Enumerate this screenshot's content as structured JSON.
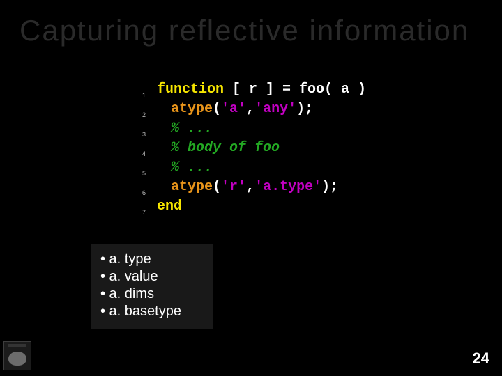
{
  "title": "Capturing reflective information",
  "code": {
    "lines": [
      {
        "n": "1",
        "tokens": [
          {
            "t": "function",
            "c": "kw"
          },
          {
            "t": " [ r ] = foo( a )",
            "c": "txt"
          }
        ]
      },
      {
        "n": "2",
        "indent": 20,
        "tokens": [
          {
            "t": "atype",
            "c": "fn"
          },
          {
            "t": "(",
            "c": "txt"
          },
          {
            "t": "'a'",
            "c": "str"
          },
          {
            "t": ",",
            "c": "txt"
          },
          {
            "t": "'any'",
            "c": "str"
          },
          {
            "t": ");",
            "c": "txt"
          }
        ]
      },
      {
        "n": "3",
        "indent": 20,
        "tokens": [
          {
            "t": "% ...",
            "c": "cmt"
          }
        ]
      },
      {
        "n": "4",
        "indent": 20,
        "tokens": [
          {
            "t": "% body of foo",
            "c": "cmt"
          }
        ]
      },
      {
        "n": "5",
        "indent": 20,
        "tokens": [
          {
            "t": "% ...",
            "c": "cmt"
          }
        ]
      },
      {
        "n": "6",
        "indent": 20,
        "tokens": [
          {
            "t": "atype",
            "c": "fn"
          },
          {
            "t": "(",
            "c": "txt"
          },
          {
            "t": "'r'",
            "c": "str"
          },
          {
            "t": ",",
            "c": "txt"
          },
          {
            "t": "'a.type'",
            "c": "str"
          },
          {
            "t": ");",
            "c": "txt"
          }
        ]
      },
      {
        "n": "7",
        "tokens": [
          {
            "t": "end",
            "c": "kw"
          }
        ]
      }
    ]
  },
  "bullets": [
    "a. type",
    "a. value",
    "a. dims",
    "a. basetype"
  ],
  "page": "24"
}
